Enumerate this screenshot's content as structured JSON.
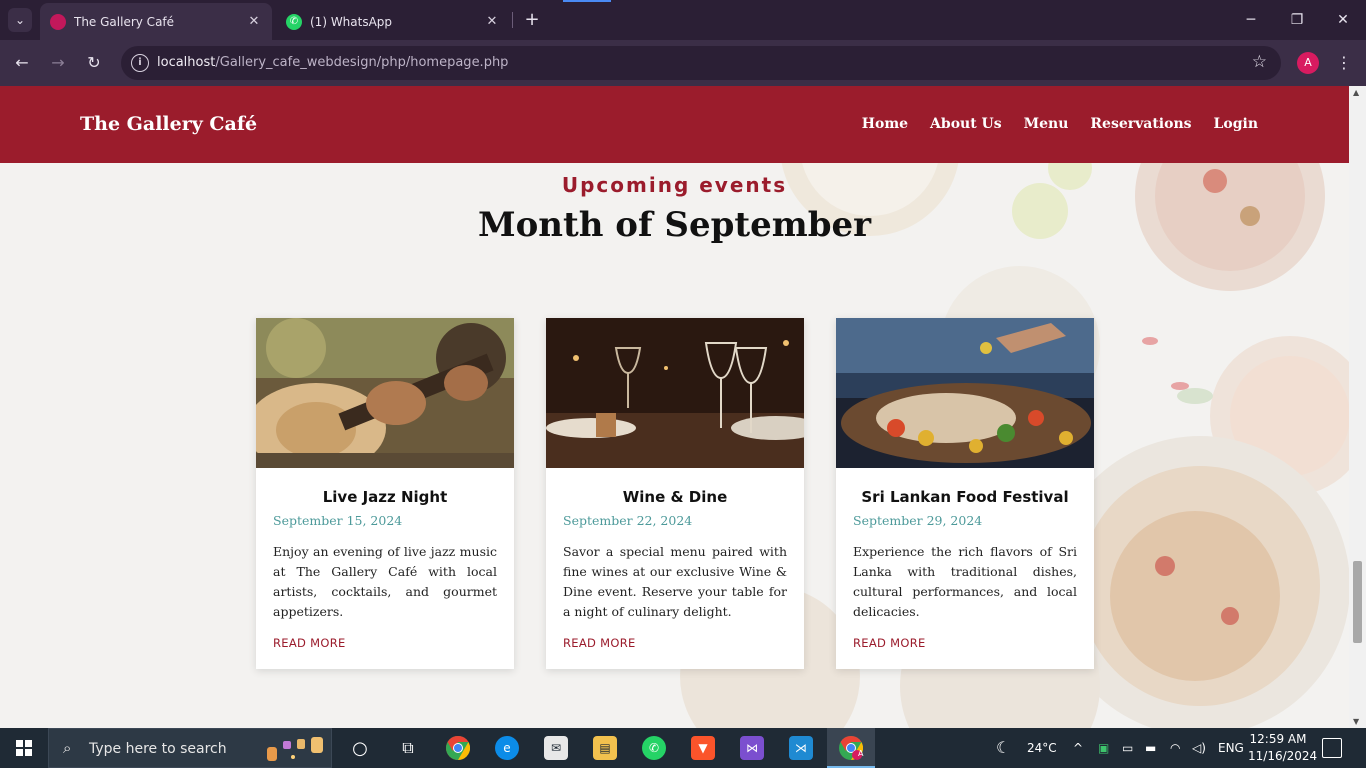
{
  "browser": {
    "tabs": [
      {
        "title": "The Gallery Café",
        "active": true
      },
      {
        "title": "(1) WhatsApp",
        "active": false
      }
    ],
    "new_tab": "+",
    "url_host": "localhost",
    "url_path": "/Gallery_cafe_webdesign/php/homepage.php",
    "profile_initial": "A"
  },
  "site": {
    "logo": "The Gallery Café",
    "nav": [
      "Home",
      "About Us",
      "Menu",
      "Reservations",
      "Login"
    ],
    "eyebrow": "Upcoming events",
    "heading": "Month of September",
    "events": [
      {
        "title": "Live Jazz Night",
        "date": "September 15, 2024",
        "text": "Enjoy an evening of live jazz music at The Gallery Café with local artists, cocktails, and gourmet appetizers.",
        "link": "READ MORE"
      },
      {
        "title": "Wine & Dine",
        "date": "September 22, 2024",
        "text": "Savor a special menu paired with fine wines at our exclusive Wine & Dine event. Reserve your table for a night of culinary delight.",
        "link": "READ MORE"
      },
      {
        "title": "Sri Lankan Food Festival",
        "date": "September 29, 2024",
        "text": "Experience the rich flavors of Sri Lanka with traditional dishes, cultural performances, and local delicacies.",
        "link": "READ MORE"
      }
    ]
  },
  "taskbar": {
    "search_placeholder": "Type here to search",
    "temperature": "24°C",
    "language": "ENG",
    "time": "12:59 AM",
    "date": "11/16/2024",
    "profile_initial": "A"
  }
}
